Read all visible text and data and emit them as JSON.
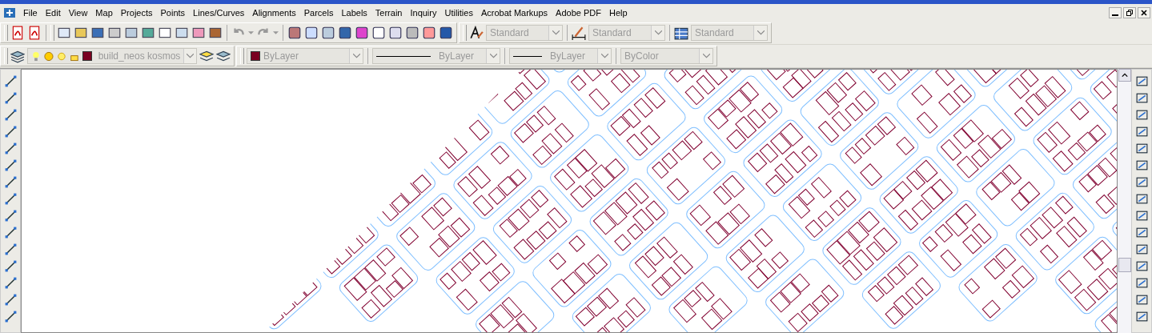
{
  "menu_bar": {
    "items": [
      {
        "label": "File"
      },
      {
        "label": "Edit"
      },
      {
        "label": "View"
      },
      {
        "label": "Map"
      },
      {
        "label": "Projects"
      },
      {
        "label": "Points"
      },
      {
        "label": "Lines/Curves"
      },
      {
        "label": "Alignments"
      },
      {
        "label": "Parcels"
      },
      {
        "label": "Labels"
      },
      {
        "label": "Terrain"
      },
      {
        "label": "Inquiry"
      },
      {
        "label": "Utilities"
      },
      {
        "label": "Acrobat Markups"
      },
      {
        "label": "Adobe PDF"
      },
      {
        "label": "Help"
      }
    ]
  },
  "style_toolbar": {
    "text_style": "Standard",
    "dimension_style": "Standard",
    "table_style": "Standard"
  },
  "properties_toolbar": {
    "layer": "build_neos kosmos",
    "color_setting": "ByLayer",
    "linetype": "ByLayer",
    "lineweight": "ByLayer",
    "plot_style": "ByColor"
  }
}
